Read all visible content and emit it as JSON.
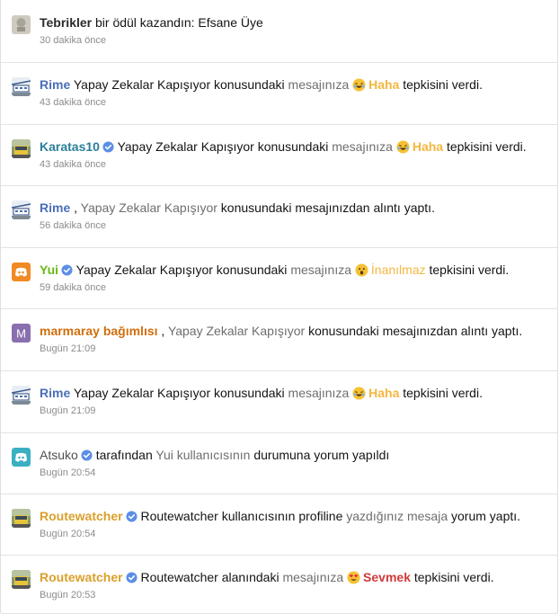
{
  "notifications": [
    {
      "avatar": "trophy-thumbnail",
      "parts": [
        {
          "t": "Tebrikler",
          "c": "u u-dark"
        },
        {
          "t": " bir ödül kazandın: Efsane Üye",
          "c": ""
        }
      ],
      "time": "30 dakika önce"
    },
    {
      "avatar": "tram-avatar",
      "parts": [
        {
          "t": "Rime",
          "c": "u u-blue"
        },
        {
          "t": " Yapay Zekalar Kapışıyor konusundaki ",
          "c": ""
        },
        {
          "t": "mesajınıza",
          "c": "g"
        },
        {
          "t": " ",
          "c": ""
        },
        {
          "t": "Haha",
          "c": "r r-haha",
          "emoji": "laugh"
        },
        {
          "t": " tepkisini verdi.",
          "c": ""
        }
      ],
      "time": "43 dakika önce"
    },
    {
      "avatar": "bus-avatar",
      "parts": [
        {
          "t": "Karatas10",
          "c": "u u-teal",
          "badge": true
        },
        {
          "t": " Yapay Zekalar Kapışıyor konusundaki ",
          "c": ""
        },
        {
          "t": "mesajınıza",
          "c": "g"
        },
        {
          "t": " ",
          "c": ""
        },
        {
          "t": "Haha",
          "c": "r r-haha",
          "emoji": "laugh"
        },
        {
          "t": " tepkisini verdi.",
          "c": ""
        }
      ],
      "time": "43 dakika önce"
    },
    {
      "avatar": "tram-avatar",
      "parts": [
        {
          "t": "Rime",
          "c": "u u-blue"
        },
        {
          "t": " , ",
          "c": ""
        },
        {
          "t": "Yapay Zekalar Kapışıyor",
          "c": "g"
        },
        {
          "t": " konusundaki mesajınızdan alıntı yaptı.",
          "c": ""
        }
      ],
      "time": "56 dakika önce"
    },
    {
      "avatar": "discord-orange-avatar",
      "parts": [
        {
          "t": "Yui",
          "c": "u u-green",
          "badge": true
        },
        {
          "t": " Yapay Zekalar Kapışıyor konusundaki ",
          "c": ""
        },
        {
          "t": "mesajınıza",
          "c": "g"
        },
        {
          "t": " ",
          "c": ""
        },
        {
          "t": "İnanılmaz",
          "c": "r r-wow",
          "emoji": "wow"
        },
        {
          "t": " tepkisini verdi.",
          "c": ""
        }
      ],
      "time": "59 dakika önce"
    },
    {
      "avatar": "letter-m-avatar",
      "parts": [
        {
          "t": "marmaray bağımlısı",
          "c": "u u-orange"
        },
        {
          "t": " , ",
          "c": ""
        },
        {
          "t": "Yapay Zekalar Kapışıyor",
          "c": "g"
        },
        {
          "t": " konusundaki mesajınızdan alıntı yaptı.",
          "c": ""
        }
      ],
      "time": "Bugün 21:09"
    },
    {
      "avatar": "tram-avatar",
      "parts": [
        {
          "t": "Rime",
          "c": "u u-blue"
        },
        {
          "t": " Yapay Zekalar Kapışıyor konusundaki ",
          "c": ""
        },
        {
          "t": "mesajınıza",
          "c": "g"
        },
        {
          "t": " ",
          "c": ""
        },
        {
          "t": "Haha",
          "c": "r r-haha",
          "emoji": "laugh"
        },
        {
          "t": " tepkisini verdi.",
          "c": ""
        }
      ],
      "time": "Bugün 21:09"
    },
    {
      "avatar": "discord-teal-avatar",
      "parts": [
        {
          "t": "Atsuko",
          "c": "u u-plain",
          "badge": true
        },
        {
          "t": " tarafından ",
          "c": ""
        },
        {
          "t": "Yui kullanıcısının",
          "c": "g"
        },
        {
          "t": " durumuna yorum yapıldı",
          "c": ""
        }
      ],
      "time": "Bugün 20:54"
    },
    {
      "avatar": "bus-avatar",
      "parts": [
        {
          "t": "Routewatcher",
          "c": "u u-gold",
          "badge": true
        },
        {
          "t": " Routewatcher kullanıcısının profiline ",
          "c": ""
        },
        {
          "t": "yazdığınız mesaja",
          "c": "g"
        },
        {
          "t": " yorum yaptı.",
          "c": ""
        }
      ],
      "time": "Bugün 20:54"
    },
    {
      "avatar": "bus-avatar",
      "parts": [
        {
          "t": "Routewatcher",
          "c": "u u-gold",
          "badge": true
        },
        {
          "t": " Routewatcher alanındaki ",
          "c": ""
        },
        {
          "t": "mesajınıza",
          "c": "g"
        },
        {
          "t": " ",
          "c": ""
        },
        {
          "t": "Sevmek",
          "c": "r r-love",
          "emoji": "heart-eyes"
        },
        {
          "t": " tepkisini verdi.",
          "c": ""
        }
      ],
      "time": "Bugün 20:53"
    }
  ],
  "avatar_letters": {
    "letter-m-avatar": "M"
  },
  "colors": {
    "haha": "#f3b740",
    "sevmek": "#d13a3a",
    "verified_badge": "#5b8fe6",
    "discord_orange": "#f08a24",
    "discord_teal": "#3ab0c2",
    "avatar_purple": "#8a6fae"
  }
}
